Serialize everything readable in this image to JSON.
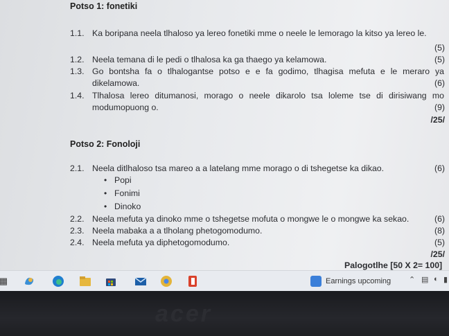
{
  "section1": {
    "title": "Potso 1: fonetiki",
    "items": [
      {
        "num": "1.1.",
        "text": "Ka boripana neela tlhaloso ya lereo fonetiki mme o neele le lemorago la kitso ya lereo le.",
        "mark": "(5)"
      },
      {
        "num": "1.2.",
        "text": "Neela temana di le pedi o tlhalosa ka ga thaego ya kelamowa.",
        "mark": "(5)"
      },
      {
        "num": "1.3.",
        "text": "Go bontsha fa o tlhalogantse potso e e fa godimo, tlhagisa mefuta e le meraro ya dikelamowa.",
        "mark": "(6)"
      },
      {
        "num": "1.4.",
        "text": "Tlhalosa lereo ditumanosi, morago o neele dikarolo tsa loleme tse di dirisiwang mo modumopuong o.",
        "mark": "(9)"
      }
    ],
    "total": "/25/"
  },
  "section2": {
    "title": "Potso 2: Fonoloji",
    "item1": {
      "num": "2.1.",
      "text": "Neela ditlhaloso tsa mareo a a latelang mme morago o di tshegetse ka dikao.",
      "mark": "(6)"
    },
    "bullets": [
      "Popi",
      "Fonimi",
      "Dinoko"
    ],
    "items": [
      {
        "num": "2.2.",
        "text": "Neela mefuta ya dinoko mme o tshegetse mofuta o mongwe le o mongwe ka sekao.",
        "mark": "(6)"
      },
      {
        "num": "2.3.",
        "text": "Neela mabaka a a tlholang phetogomodumo.",
        "mark": "(8)"
      },
      {
        "num": "2.4.",
        "text": "Neela mefuta ya diphetogomodumo.",
        "mark": "(5)"
      }
    ],
    "total": "/25/"
  },
  "footer": {
    "text": "Palogotlhe [50 X 2= 100]"
  },
  "taskbar": {
    "search_label": "Earnings upcoming"
  },
  "bezel": {
    "brand": "acer"
  },
  "colors": {
    "search_icon": "#3b7fd9",
    "office_icon": "#d9412b",
    "chrome_icon": "#e3b43a"
  }
}
